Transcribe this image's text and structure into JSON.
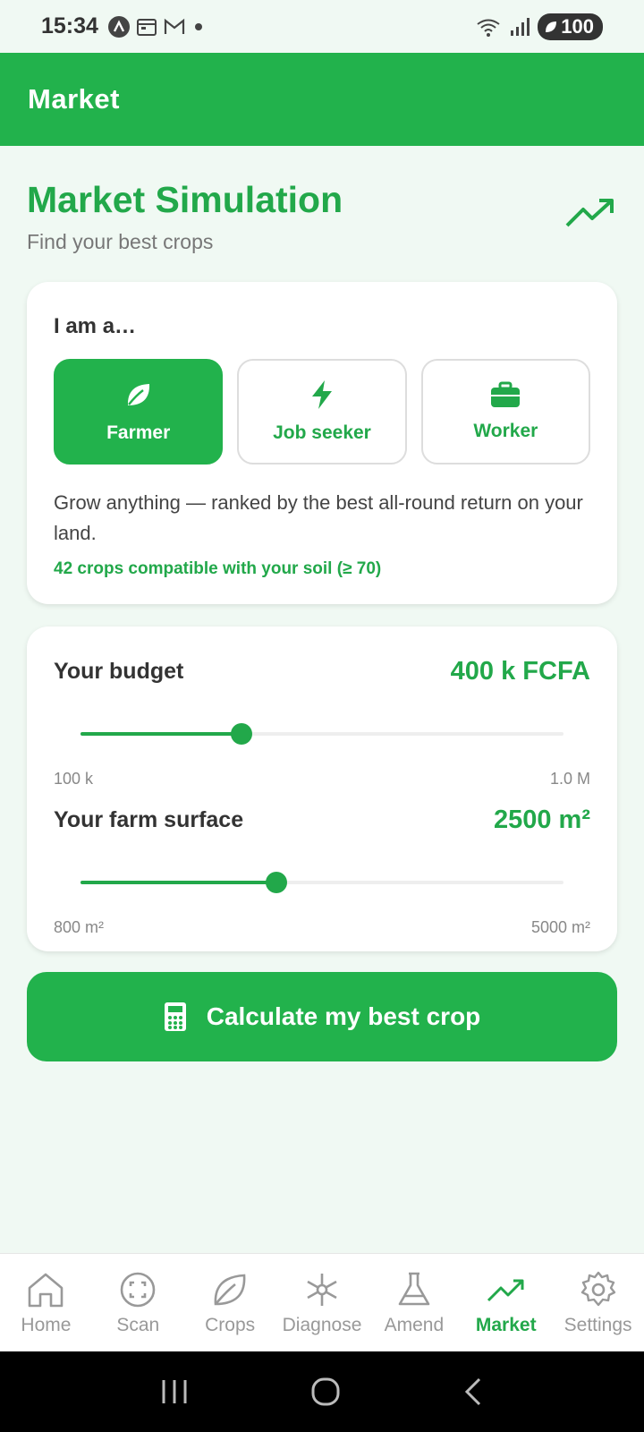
{
  "status_bar": {
    "time": "15:34",
    "battery": "100",
    "icons": [
      "a-icon",
      "calendar-icon",
      "gmail-icon",
      "dot-icon",
      "wifi-icon",
      "signal-icon"
    ]
  },
  "app_bar": {
    "title": "Market"
  },
  "header": {
    "title": "Market Simulation",
    "subtitle": "Find your best crops"
  },
  "role": {
    "label": "I am a…",
    "options": [
      {
        "label": "Farmer",
        "icon": "leaf-icon",
        "selected": true
      },
      {
        "label": "Job seeker",
        "icon": "lightning-icon",
        "selected": false
      },
      {
        "label": "Worker",
        "icon": "briefcase-icon",
        "selected": false
      }
    ],
    "description": "Grow anything — ranked by the best all-round return on your land.",
    "compat": "42 crops compatible with your soil (≥ 70)"
  },
  "budget": {
    "title": "Your budget",
    "value": "400 k FCFA",
    "min_label": "100 k",
    "max_label": "1.0 M",
    "fraction": 0.333
  },
  "surface": {
    "title": "Your farm surface",
    "value": "2500 m²",
    "min_label": "800 m²",
    "max_label": "5000 m²",
    "fraction": 0.405
  },
  "calculate": {
    "label": "Calculate my best crop",
    "icon": "calculator-icon"
  },
  "nav": [
    {
      "label": "Home",
      "icon": "home-icon"
    },
    {
      "label": "Scan",
      "icon": "scan-icon"
    },
    {
      "label": "Crops",
      "icon": "leaf-icon"
    },
    {
      "label": "Diagnose",
      "icon": "diagnose-icon"
    },
    {
      "label": "Amend",
      "icon": "flask-icon"
    },
    {
      "label": "Market",
      "icon": "trend-icon",
      "active": true
    },
    {
      "label": "Settings",
      "icon": "gear-icon"
    }
  ],
  "colors": {
    "accent": "#22b24c",
    "accent_text": "#22a84a",
    "background": "#f0f9f3"
  }
}
